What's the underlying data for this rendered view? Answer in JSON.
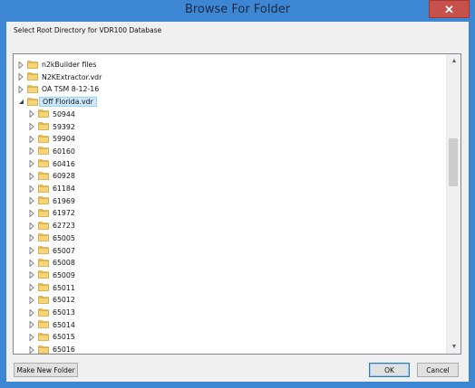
{
  "window": {
    "title": "Browse For Folder",
    "close_glyph": "✕"
  },
  "prompt": "Select Root Directory for VDR100 Database",
  "tree": {
    "top_items": [
      {
        "label": "n2kBuilder files",
        "expanded": false
      },
      {
        "label": "N2KExtractor.vdr",
        "expanded": false
      },
      {
        "label": "OA TSM 8-12-16",
        "expanded": false
      },
      {
        "label": "Off Florida.vdr",
        "expanded": true,
        "selected": true
      }
    ],
    "children": [
      "50944",
      "59392",
      "59904",
      "60160",
      "60416",
      "60928",
      "61184",
      "61969",
      "61972",
      "62723",
      "65005",
      "65007",
      "65008",
      "65009",
      "65011",
      "65012",
      "65013",
      "65014",
      "65015",
      "65016"
    ]
  },
  "buttons": {
    "new_folder": "Make New Folder",
    "ok": "OK",
    "cancel": "Cancel"
  },
  "colors": {
    "title_bar": "#3d86d3",
    "close": "#c7504a",
    "selection": "#cce8ff",
    "folder": "#e8bf52"
  }
}
